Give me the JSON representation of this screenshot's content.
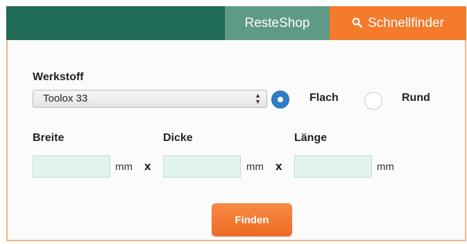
{
  "nav": {
    "tabs": [
      {
        "label": "ResteShop"
      },
      {
        "label": "Schnellfinder",
        "icon": "search-icon",
        "active": true
      }
    ]
  },
  "form": {
    "werkstoff": {
      "label": "Werkstoff",
      "selected": "Toolox 33"
    },
    "shape": {
      "options": [
        {
          "label": "Flach",
          "checked": true
        },
        {
          "label": "Rund",
          "checked": false
        }
      ]
    },
    "dimensions": [
      {
        "label": "Breite",
        "value": "",
        "unit": "mm"
      },
      {
        "label": "Dicke",
        "value": "",
        "unit": "mm"
      },
      {
        "label": "Länge",
        "value": "",
        "unit": "mm"
      }
    ],
    "separator": "x",
    "submit_label": "Finden"
  },
  "colors": {
    "header_bg": "#1f6b57",
    "resteshop_tab": "#5e9a85",
    "accent_orange": "#f47a2c",
    "radio_checked": "#2f7dc4",
    "input_bg": "#e2f4ef"
  }
}
